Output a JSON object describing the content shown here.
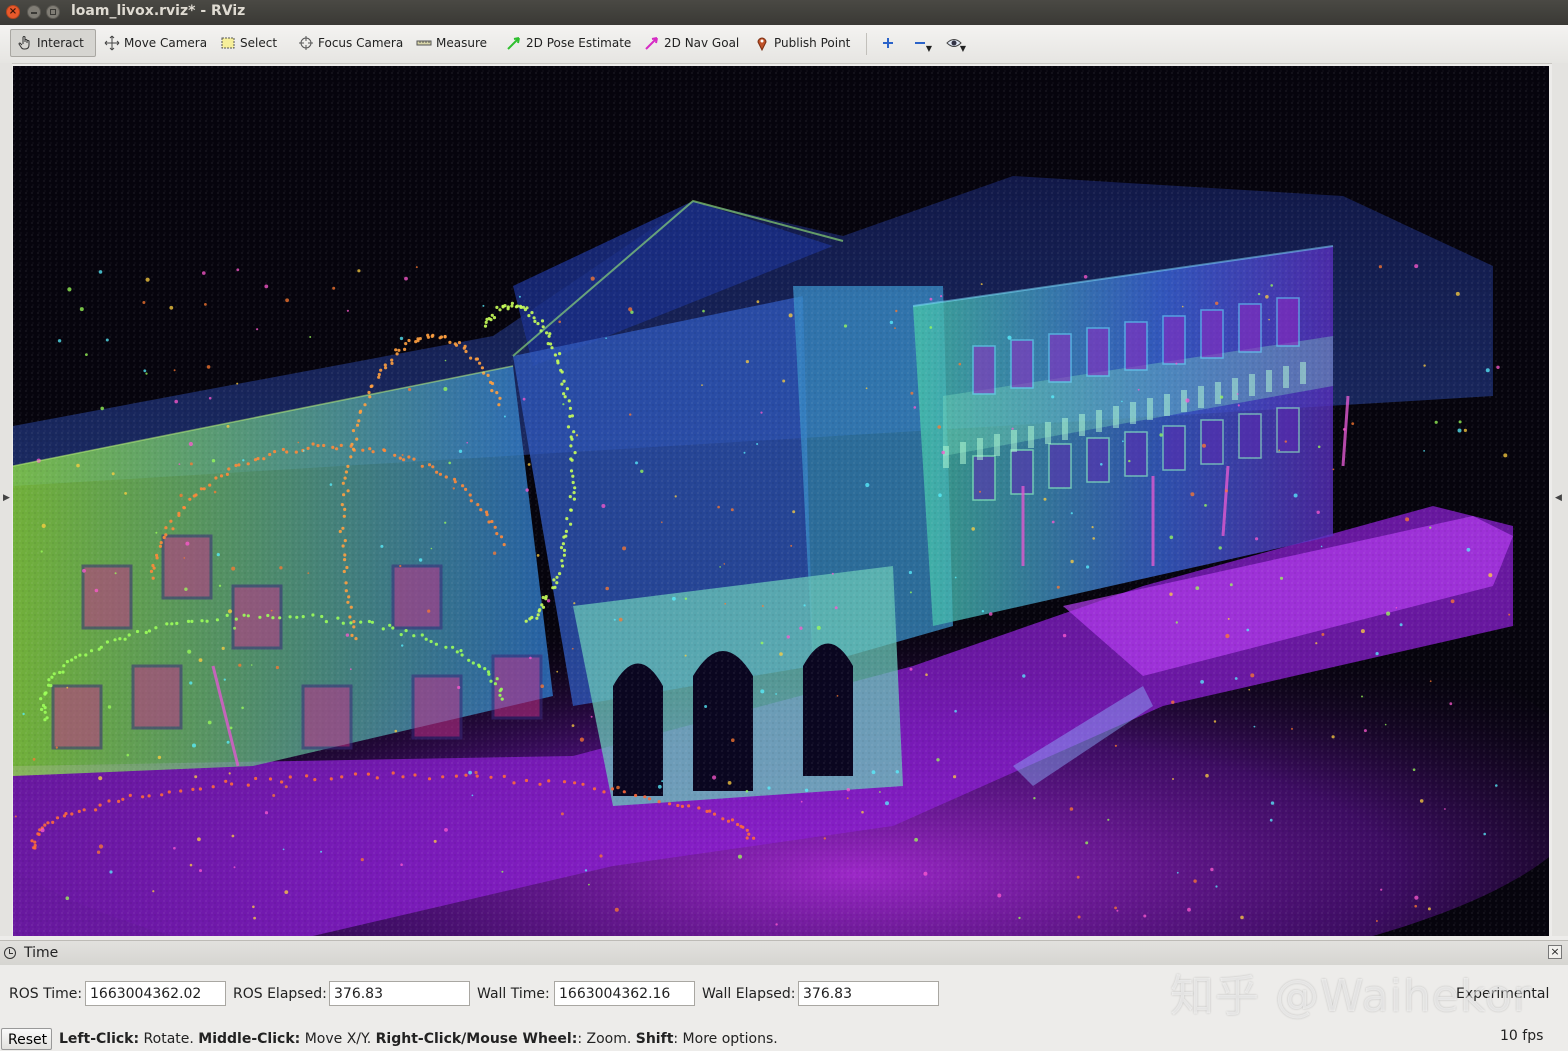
{
  "window": {
    "title": "loam_livox.rviz* - RViz"
  },
  "toolbar": {
    "tools": [
      {
        "label": "Interact",
        "icon": "hand-pointer-icon"
      },
      {
        "label": "Move Camera",
        "icon": "move-arrows-icon"
      },
      {
        "label": "Select",
        "icon": "selection-box-icon"
      },
      {
        "label": "Focus Camera",
        "icon": "crosshair-icon"
      },
      {
        "label": "Measure",
        "icon": "ruler-icon"
      },
      {
        "label": "2D Pose Estimate",
        "icon": "green-arrow-icon"
      },
      {
        "label": "2D Nav Goal",
        "icon": "pink-arrow-icon"
      },
      {
        "label": "Publish Point",
        "icon": "map-pin-icon"
      }
    ],
    "active_tool": "Interact",
    "extra_icons": [
      "plus-icon",
      "minus-icon",
      "eye-icon"
    ]
  },
  "time_panel": {
    "title": "Time",
    "ros_time_label": "ROS Time:",
    "ros_time": "1663004362.02",
    "ros_elapsed_label": "ROS Elapsed:",
    "ros_elapsed": "376.83",
    "wall_time_label": "Wall Time:",
    "wall_time": "1663004362.16",
    "wall_elapsed_label": "Wall Elapsed:",
    "wall_elapsed": "376.83",
    "experimental_label": "Experimental"
  },
  "watermark": "知乎 @Waihekor",
  "status": {
    "reset_label": "Reset",
    "help_bold_1": "Left-Click:",
    "help_text_1": " Rotate. ",
    "help_bold_2": "Middle-Click:",
    "help_text_2": " Move X/Y. ",
    "help_bold_3": "Right-Click/Mouse Wheel:",
    "help_text_3": ": Zoom. ",
    "help_bold_4": "Shift",
    "help_text_4": ": More options.",
    "fps": "10 fps"
  },
  "colors": {
    "viewport_bg": "#06040d",
    "ground": "#a020d8",
    "facade": "#7be04a",
    "facade_blue": "#4a62d8",
    "trajectory": "#ff7a30"
  }
}
